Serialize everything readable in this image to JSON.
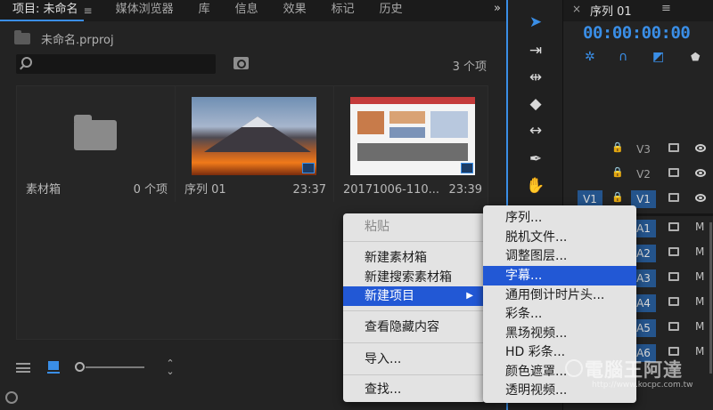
{
  "tabs": [
    {
      "label": "项目: 未命名"
    },
    {
      "label": "媒体浏览器"
    },
    {
      "label": "库"
    },
    {
      "label": "信息"
    },
    {
      "label": "效果"
    },
    {
      "label": "标记"
    },
    {
      "label": "历史"
    }
  ],
  "tab_menu": "≡",
  "tab_more": "»",
  "project": {
    "file_name": "未命名.prproj",
    "item_count": "3 个项",
    "items": [
      {
        "name": "素材箱",
        "info": "0 个项",
        "kind": "bin"
      },
      {
        "name": "序列 01",
        "info": "23:37",
        "kind": "sequence"
      },
      {
        "name": "20171006-110...",
        "info": "23:39",
        "kind": "clip"
      }
    ]
  },
  "timeline": {
    "close": "×",
    "title": "序列 01",
    "menu": "≡",
    "timecode": "00:00:00:00",
    "video_tracks": [
      {
        "label": "V3",
        "source": "",
        "highlight": false
      },
      {
        "label": "V2",
        "source": "",
        "highlight": false
      },
      {
        "label": "V1",
        "source": "V1",
        "highlight": true
      }
    ],
    "audio_tracks": [
      "A1",
      "A2",
      "A3",
      "A4",
      "A5",
      "A6"
    ],
    "mute_label": "M",
    "lock_glyph": "🔒"
  },
  "context_menu": {
    "items": [
      {
        "label": "粘贴",
        "disabled": true
      },
      {
        "label": "新建素材箱"
      },
      {
        "label": "新建搜索素材箱"
      },
      {
        "label": "新建项目",
        "active": true,
        "submenu_arrow": "▶"
      },
      {
        "label": "查看隐藏内容"
      },
      {
        "label": "导入..."
      },
      {
        "label": "查找..."
      }
    ]
  },
  "submenu": {
    "items": [
      {
        "label": "序列..."
      },
      {
        "label": "脱机文件..."
      },
      {
        "label": "调整图层..."
      },
      {
        "label": "字幕...",
        "active": true
      },
      {
        "label": "通用倒计时片头..."
      },
      {
        "label": "彩条..."
      },
      {
        "label": "黑场视频..."
      },
      {
        "label": "HD 彩条..."
      },
      {
        "label": "颜色遮罩..."
      },
      {
        "label": "透明视频..."
      }
    ]
  },
  "watermark": {
    "text": "電腦王阿達",
    "url": "http://www.kocpc.com.tw"
  },
  "colors": {
    "accent": "#3a8ee6",
    "menu_highlight": "#2258d5",
    "track_highlight": "#24548c"
  }
}
